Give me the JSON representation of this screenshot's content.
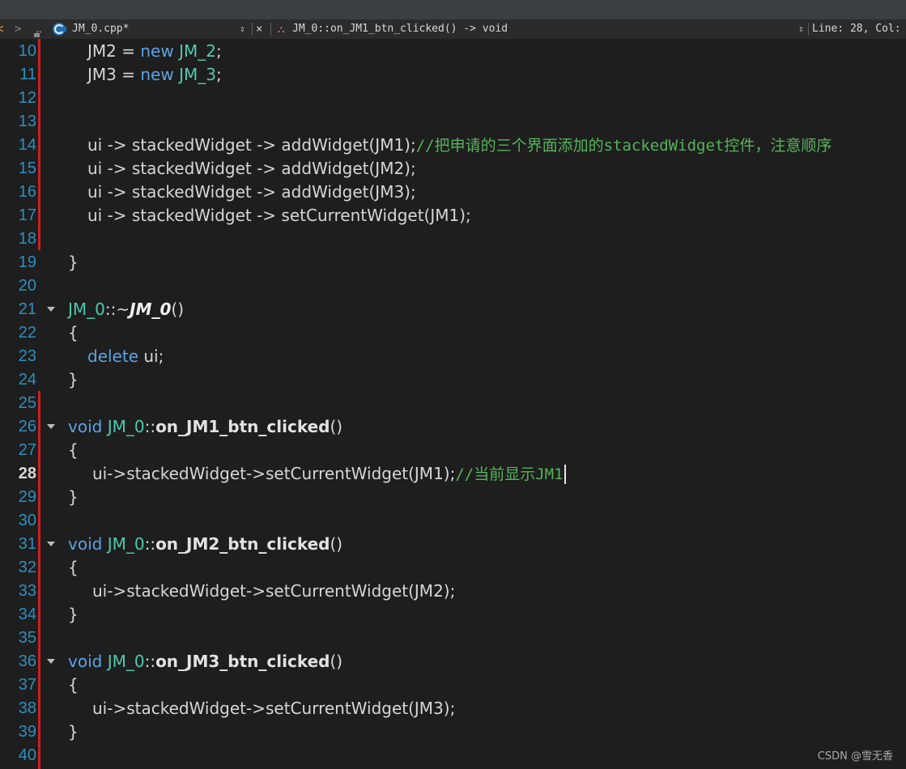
{
  "toolbar": {
    "back_glyph": "<",
    "forward_glyph": ">",
    "file_name": "JM_0.cpp*",
    "file_selector_glyph": "⇕",
    "close_glyph": "×",
    "symbol_glyph": "⛬",
    "symbol": "JM_0::on_JM1_btn_clicked() -> void",
    "line_selector_glyph": "⇕",
    "line_col": "Line: 28, Col:"
  },
  "colors": {
    "keyword": "#5aa3e6",
    "class": "#4fc9b0",
    "comment": "#56b35a",
    "line_number": "#2f8fbf",
    "modified_marker": "#cc1f1f",
    "background": "#1e1e1e"
  },
  "editor": {
    "current_line": 28,
    "lines": [
      {
        "num": "10",
        "tokens": [
          {
            "t": "JM2 = ",
            "c": ""
          },
          {
            "t": "new ",
            "c": "kw"
          },
          {
            "t": "JM_2",
            "c": "cls"
          },
          {
            "t": ";",
            "c": ""
          }
        ]
      },
      {
        "num": "11",
        "tokens": [
          {
            "t": "JM3 = ",
            "c": ""
          },
          {
            "t": "new ",
            "c": "kw"
          },
          {
            "t": "JM_3",
            "c": "cls"
          },
          {
            "t": ";",
            "c": ""
          }
        ]
      },
      {
        "num": "12",
        "tokens": []
      },
      {
        "num": "13",
        "tokens": []
      },
      {
        "num": "14",
        "tokens": [
          {
            "t": "ui -> stackedWidget -> addWidget(JM1);",
            "c": ""
          },
          {
            "t": "//把申请的三个界面添加的stackedWidget控件，注意顺序",
            "c": "cm"
          }
        ]
      },
      {
        "num": "15",
        "tokens": [
          {
            "t": "ui -> stackedWidget -> addWidget(JM2);",
            "c": ""
          }
        ]
      },
      {
        "num": "16",
        "tokens": [
          {
            "t": "ui -> stackedWidget -> addWidget(JM3);",
            "c": ""
          }
        ]
      },
      {
        "num": "17",
        "tokens": [
          {
            "t": "ui -> stackedWidget -> setCurrentWidget(JM1);",
            "c": ""
          }
        ]
      },
      {
        "num": "18",
        "tokens": []
      },
      {
        "num": "19",
        "tokens": [
          {
            "t": "}",
            "c": ""
          }
        ]
      },
      {
        "num": "20",
        "tokens": []
      },
      {
        "num": "21",
        "tokens": [
          {
            "t": "JM_0",
            "c": "cls"
          },
          {
            "t": "::~",
            "c": ""
          },
          {
            "t": "JM_0",
            "c": "dtor"
          },
          {
            "t": "()",
            "c": ""
          }
        ]
      },
      {
        "num": "22",
        "tokens": [
          {
            "t": "{",
            "c": ""
          }
        ]
      },
      {
        "num": "23",
        "tokens": [
          {
            "t": "delete ",
            "c": "kw"
          },
          {
            "t": "ui;",
            "c": ""
          }
        ]
      },
      {
        "num": "24",
        "tokens": [
          {
            "t": "}",
            "c": ""
          }
        ]
      },
      {
        "num": "25",
        "tokens": []
      },
      {
        "num": "26",
        "tokens": [
          {
            "t": "void ",
            "c": "kw"
          },
          {
            "t": "JM_0",
            "c": "cls"
          },
          {
            "t": "::",
            "c": ""
          },
          {
            "t": "on_JM1_btn_clicked",
            "c": "fn"
          },
          {
            "t": "()",
            "c": ""
          }
        ]
      },
      {
        "num": "27",
        "tokens": [
          {
            "t": "{",
            "c": ""
          }
        ]
      },
      {
        "num": "28",
        "tokens": [
          {
            "t": "ui->stackedWidget->setCurrentWidget(JM1);",
            "c": ""
          },
          {
            "t": "//当前显示JM1",
            "c": "cm"
          }
        ]
      },
      {
        "num": "29",
        "tokens": [
          {
            "t": "}",
            "c": ""
          }
        ]
      },
      {
        "num": "30",
        "tokens": []
      },
      {
        "num": "31",
        "tokens": [
          {
            "t": "void ",
            "c": "kw"
          },
          {
            "t": "JM_0",
            "c": "cls"
          },
          {
            "t": "::",
            "c": ""
          },
          {
            "t": "on_JM2_btn_clicked",
            "c": "fn"
          },
          {
            "t": "()",
            "c": ""
          }
        ]
      },
      {
        "num": "32",
        "tokens": [
          {
            "t": "{",
            "c": ""
          }
        ]
      },
      {
        "num": "33",
        "tokens": [
          {
            "t": "ui->stackedWidget->setCurrentWidget(JM2);",
            "c": ""
          }
        ]
      },
      {
        "num": "34",
        "tokens": [
          {
            "t": "}",
            "c": ""
          }
        ]
      },
      {
        "num": "35",
        "tokens": []
      },
      {
        "num": "36",
        "tokens": [
          {
            "t": "void ",
            "c": "kw"
          },
          {
            "t": "JM_0",
            "c": "cls"
          },
          {
            "t": "::",
            "c": ""
          },
          {
            "t": "on_JM3_btn_clicked",
            "c": "fn"
          },
          {
            "t": "()",
            "c": ""
          }
        ]
      },
      {
        "num": "37",
        "tokens": [
          {
            "t": "{",
            "c": ""
          }
        ]
      },
      {
        "num": "38",
        "tokens": [
          {
            "t": "ui->stackedWidget->setCurrentWidget(JM3);",
            "c": ""
          }
        ]
      },
      {
        "num": "39",
        "tokens": [
          {
            "t": "}",
            "c": ""
          }
        ]
      },
      {
        "num": "40",
        "tokens": []
      }
    ]
  },
  "watermark": "CSDN @雪无香"
}
